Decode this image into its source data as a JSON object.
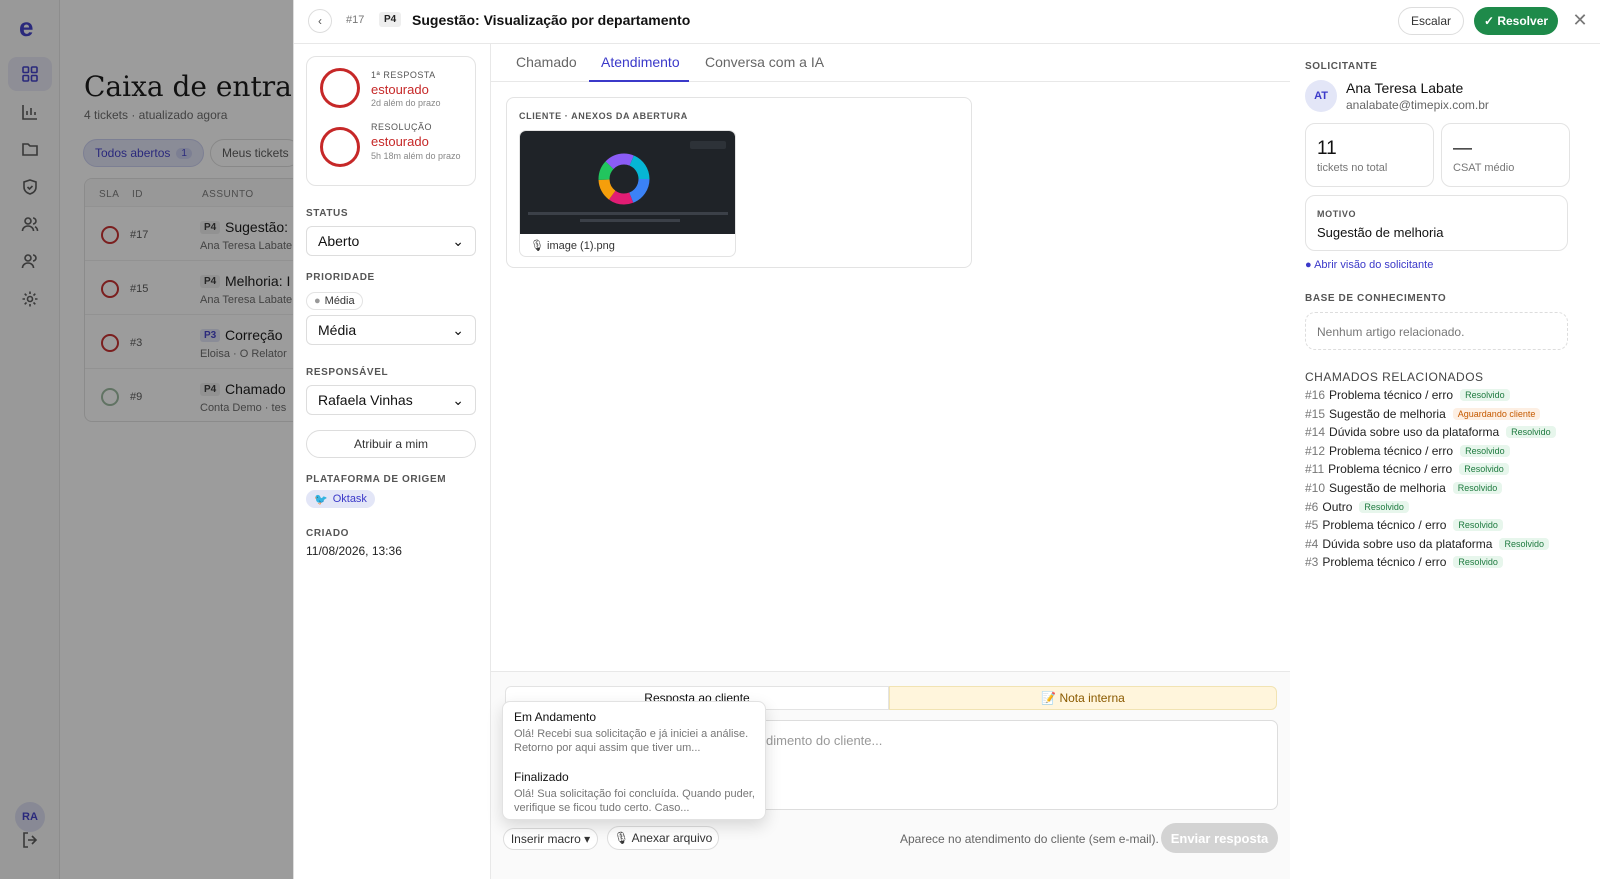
{
  "sidebar": {
    "logo": "e",
    "avatar": "RA"
  },
  "inbox": {
    "title": "Caixa de entrada",
    "subtitle": "4 tickets · atualizado agora",
    "filters": [
      {
        "label": "Todos abertos",
        "count": "1"
      },
      {
        "label": "Meus tickets"
      }
    ],
    "columns": [
      "SLA",
      "ID",
      "ASSUNTO"
    ],
    "rows": [
      {
        "id": "#17",
        "priority": "P4",
        "subject": "Sugestão:",
        "requester": "Ana Teresa Labate"
      },
      {
        "id": "#15",
        "priority": "P4",
        "subject": "Melhoria: I",
        "requester": "Ana Teresa Labate"
      },
      {
        "id": "#3",
        "priority": "P3",
        "subject": "Correção",
        "requester": "Eloisa · O Relator"
      },
      {
        "id": "#9",
        "priority": "P4",
        "subject": "Chamado",
        "requester": "Conta Demo · tes"
      }
    ]
  },
  "ticket": {
    "number": "#17",
    "priority": "P4",
    "title": "Sugestão: Visualização por departamento",
    "back_icon": "chevron-left-icon",
    "escalate_label": "Escalar",
    "resolve_label": "✓ Resolver",
    "close_icon": "close-icon"
  },
  "sla": {
    "first_response": {
      "label": "1ª RESPOSTA",
      "status": "estourado",
      "note": "2d além do prazo"
    },
    "resolution": {
      "label": "RESOLUÇÃO",
      "status": "estourado",
      "note": "5h 18m além do prazo"
    }
  },
  "left": {
    "status_label": "STATUS",
    "status_value": "Aberto",
    "priority_label": "PRIORIDADE",
    "priority_chip": "Média",
    "priority_value": "Média",
    "assignee_label": "RESPONSÁVEL",
    "assignee_value": "Rafaela Vinhas",
    "assign_me_label": "Atribuir a mim",
    "platform_label": "PLATAFORMA DE ORIGEM",
    "platform_value": "Oktask",
    "created_label": "CRIADO",
    "created_value": "11/08/2026, 13:36"
  },
  "tabs": [
    "Chamado",
    "Atendimento",
    "Conversa com a IA"
  ],
  "attachments": {
    "caption": "CLIENTE · ANEXOS DA ABERTURA",
    "file": "image (1).png"
  },
  "composer": {
    "reply_tab": "Resposta ao cliente",
    "note_tab": "📝 Nota interna",
    "placeholder": "dimento do cliente...",
    "macro_label": "Inserir macro ▾",
    "attach_label": "🎙 Anexar arquivo",
    "hint": "Aparece no atendimento do cliente (sem e-mail).",
    "send_label": "Enviar resposta",
    "macros": [
      {
        "title": "Em Andamento",
        "desc": "Olá! Recebi sua solicitação e já iniciei a análise. Retorno por aqui assim que tiver um..."
      },
      {
        "title": "Finalizado",
        "desc": "Olá! Sua solicitação foi concluída. Quando puder, verifique se ficou tudo certo. Caso..."
      }
    ]
  },
  "requester": {
    "section_label": "SOLICITANTE",
    "initials": "AT",
    "name": "Ana Teresa Labate",
    "email": "analabate@timepix.com.br",
    "tickets_total": "11",
    "tickets_label": "tickets no total",
    "csat": "—",
    "csat_label": "CSAT médio",
    "reason_label": "MOTIVO",
    "reason_value": "Sugestão de melhoria",
    "open_view_link": "● Abrir visão do solicitante",
    "kb_label": "BASE DE CONHECIMENTO",
    "kb_empty": "Nenhum artigo relacionado.",
    "related_label": "CHAMADOS RELACIONADOS",
    "related": [
      {
        "id": "#16",
        "subject": "Problema técnico / erro",
        "status": "Resolvido"
      },
      {
        "id": "#15",
        "subject": "Sugestão de melhoria",
        "status": "Aguardando cliente"
      },
      {
        "id": "#14",
        "subject": "Dúvida sobre uso da plataforma",
        "status": "Resolvido"
      },
      {
        "id": "#12",
        "subject": "Problema técnico / erro",
        "status": "Resolvido"
      },
      {
        "id": "#11",
        "subject": "Problema técnico / erro",
        "status": "Resolvido"
      },
      {
        "id": "#10",
        "subject": "Sugestão de melhoria",
        "status": "Resolvido"
      },
      {
        "id": "#6",
        "subject": "Outro",
        "status": "Resolvido"
      },
      {
        "id": "#5",
        "subject": "Problema técnico / erro",
        "status": "Resolvido"
      },
      {
        "id": "#4",
        "subject": "Dúvida sobre uso da plataforma",
        "status": "Resolvido"
      },
      {
        "id": "#3",
        "subject": "Problema técnico / erro",
        "status": "Resolvido"
      }
    ]
  }
}
